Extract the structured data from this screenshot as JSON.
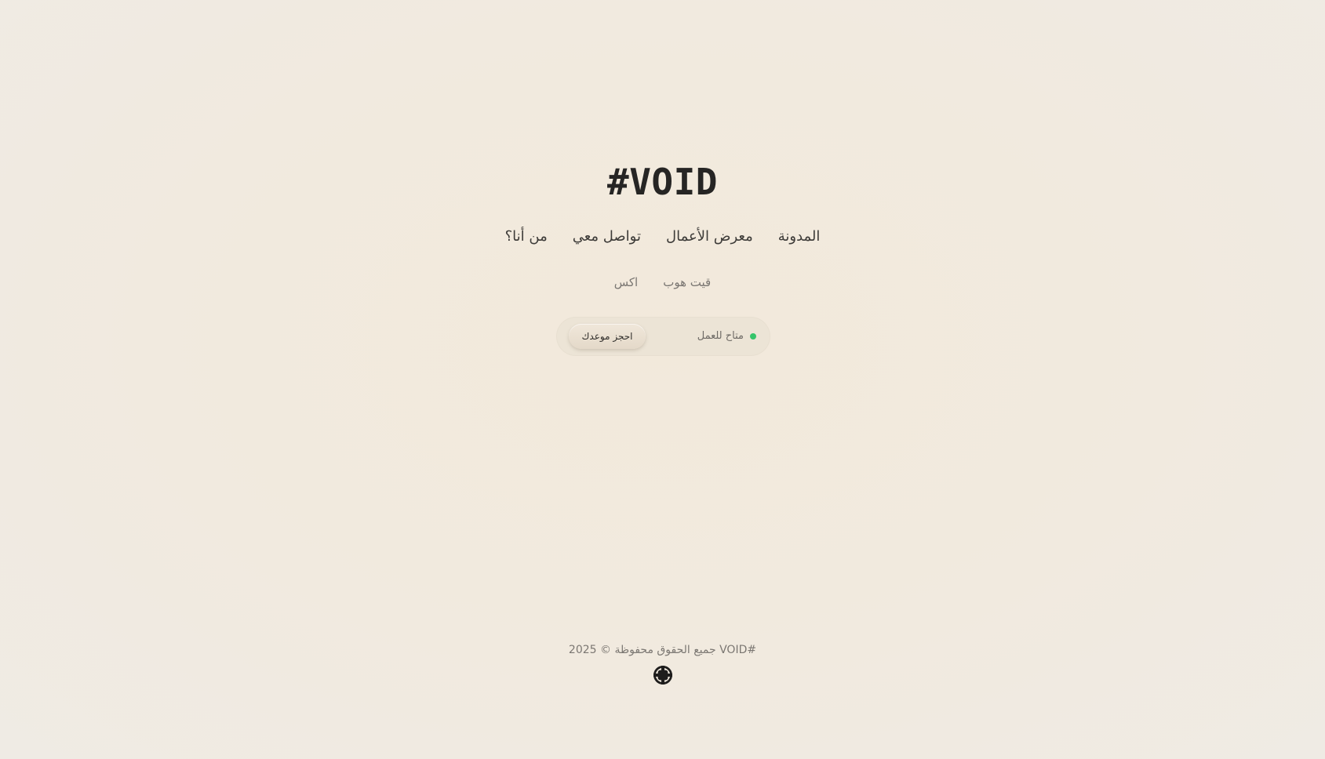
{
  "header": {
    "logo": "#VOID"
  },
  "nav": {
    "items": [
      {
        "label": "المدونة"
      },
      {
        "label": "معرض الأعمال"
      },
      {
        "label": "تواصل معي"
      },
      {
        "label": "من أنا؟"
      }
    ]
  },
  "social": {
    "items": [
      {
        "label": "قيت هوب"
      },
      {
        "label": "اكس"
      }
    ]
  },
  "availability": {
    "status_text": "متاح للعمل",
    "status_color": "#35c46a",
    "book_label": "احجز موعدك"
  },
  "footer": {
    "copyright": "#VOID جميع الحقوق محفوظة © 2025",
    "icon": "lifebuoy-icon"
  }
}
